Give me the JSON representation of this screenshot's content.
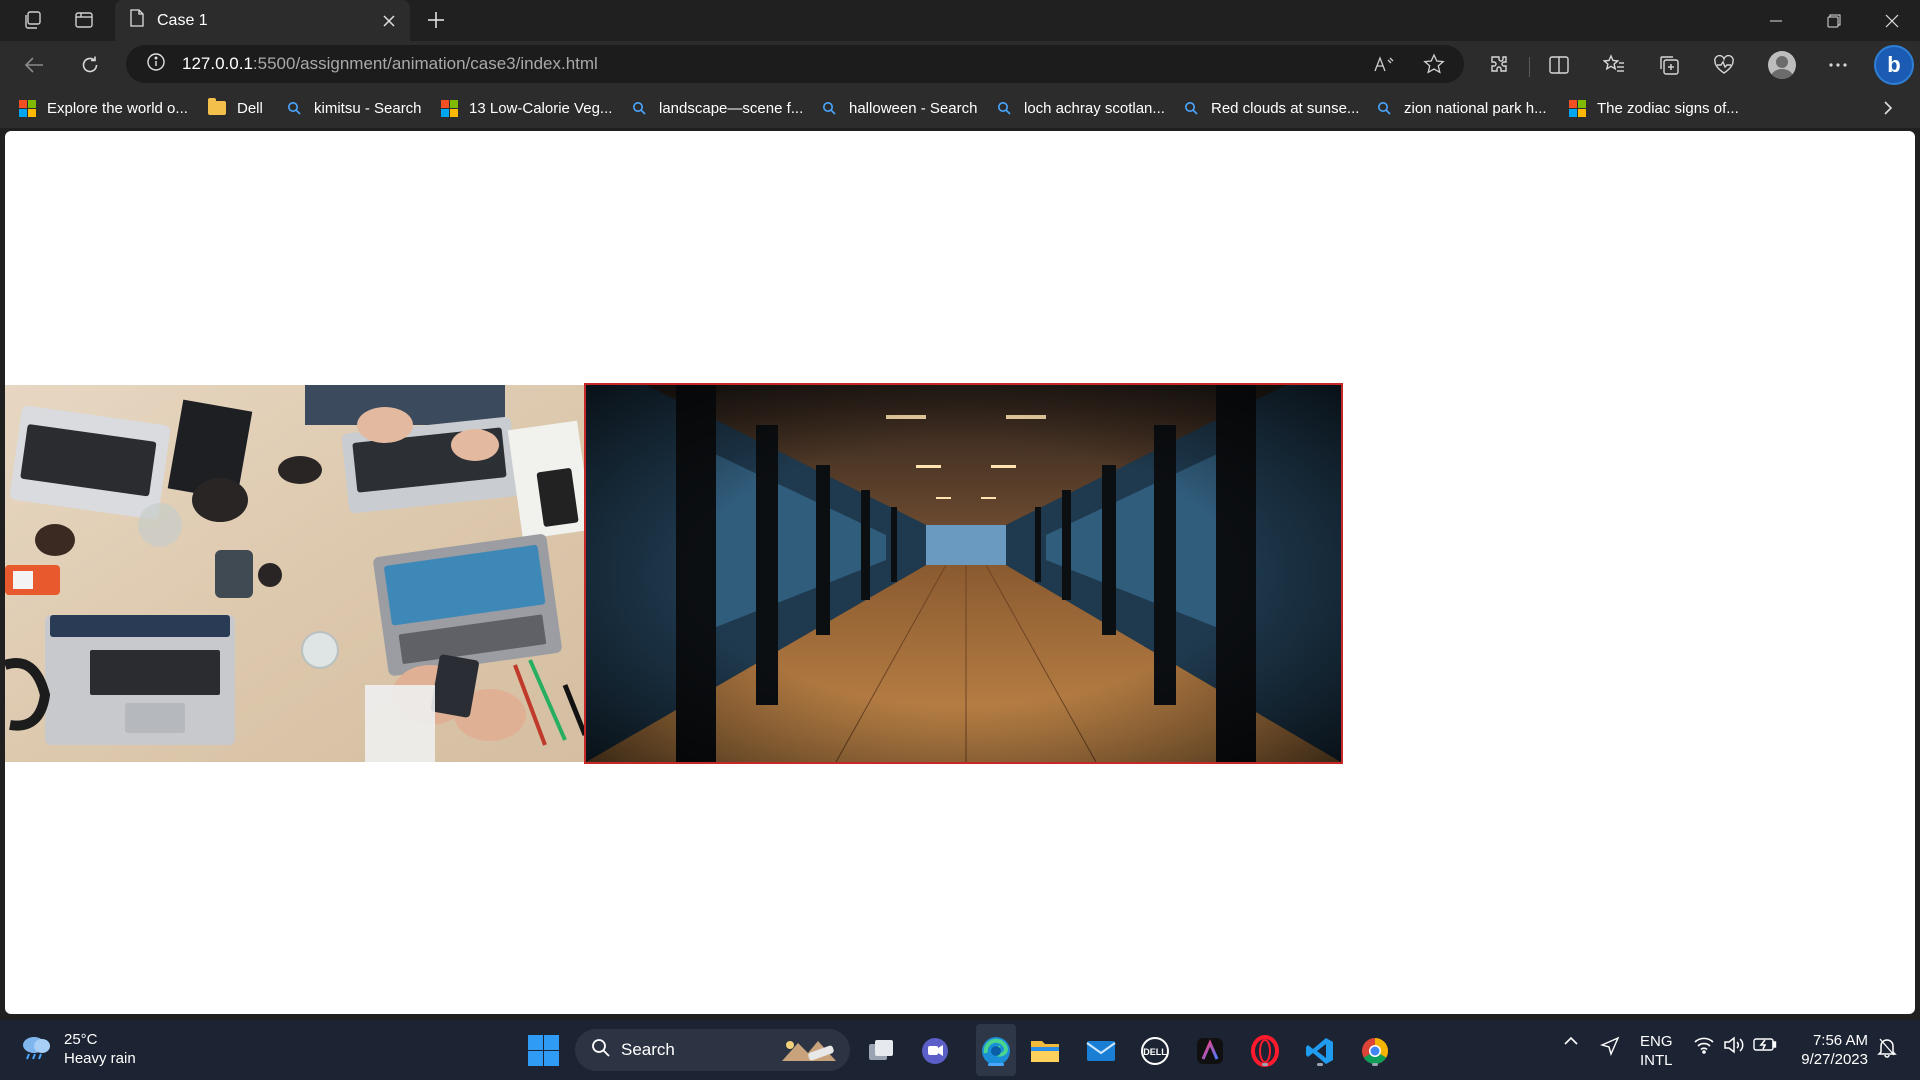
{
  "browser": {
    "tab_title": "Case 1",
    "url_host": "127.0.0.1",
    "url_rest": ":5500/assignment/animation/case3/index.html",
    "bookmarks": [
      {
        "label": "Explore the world o...",
        "icon": "microsoft-icon"
      },
      {
        "label": "Dell",
        "icon": "folder-icon"
      },
      {
        "label": "kimitsu - Search",
        "icon": "search-icon"
      },
      {
        "label": "13 Low-Calorie Veg...",
        "icon": "microsoft-icon"
      },
      {
        "label": "landscape—scene f...",
        "icon": "search-icon"
      },
      {
        "label": "halloween - Search",
        "icon": "search-icon"
      },
      {
        "label": "loch achray scotlan...",
        "icon": "search-icon"
      },
      {
        "label": "Red clouds at sunse...",
        "icon": "search-icon"
      },
      {
        "label": "zion national park h...",
        "icon": "search-icon"
      },
      {
        "label": "The zodiac signs of...",
        "icon": "microsoft-icon"
      }
    ]
  },
  "page": {
    "images": [
      {
        "description": "workspace-desk-laptops-photo"
      },
      {
        "description": "office-corridor-glass-walls-photo"
      }
    ],
    "accent_border_color": "#c62828"
  },
  "taskbar": {
    "weather_temp": "25°C",
    "weather_desc": "Heavy rain",
    "search_label": "Search",
    "lang_line1": "ENG",
    "lang_line2": "INTL",
    "time": "7:56 AM",
    "date": "9/27/2023"
  },
  "colors": {
    "accent": "#2f9bf5",
    "titlebar": "#202020",
    "toolbar": "#2c2c2c",
    "taskbar": "#1c2433"
  }
}
